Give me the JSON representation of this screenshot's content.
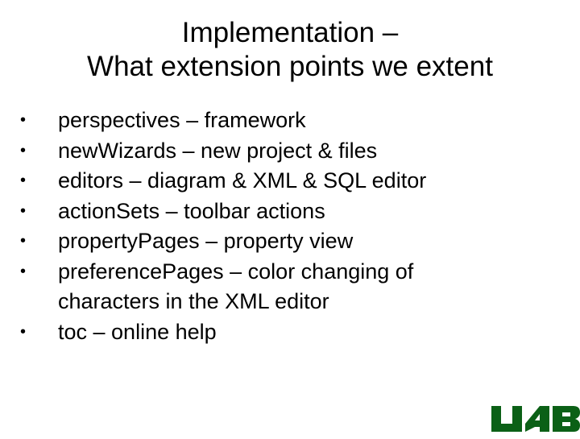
{
  "slide": {
    "title_lines": [
      "Implementation –",
      "What extension points we extent"
    ],
    "bullets": [
      {
        "label": "perspectives – framework"
      },
      {
        "label": "newWizards – new project & files"
      },
      {
        "label": "editors – diagram & XML & SQL editor"
      },
      {
        "label": "actionSets – toolbar actions"
      },
      {
        "label": "propertyPages – property view"
      },
      {
        "label": "preferencePages – color changing of characters in the XML editor"
      },
      {
        "label": "toc – online help"
      }
    ],
    "bullet_glyph": "•",
    "logo": {
      "text": "UAB",
      "icon": "uab-logo-icon",
      "color": "#0b6016"
    }
  }
}
